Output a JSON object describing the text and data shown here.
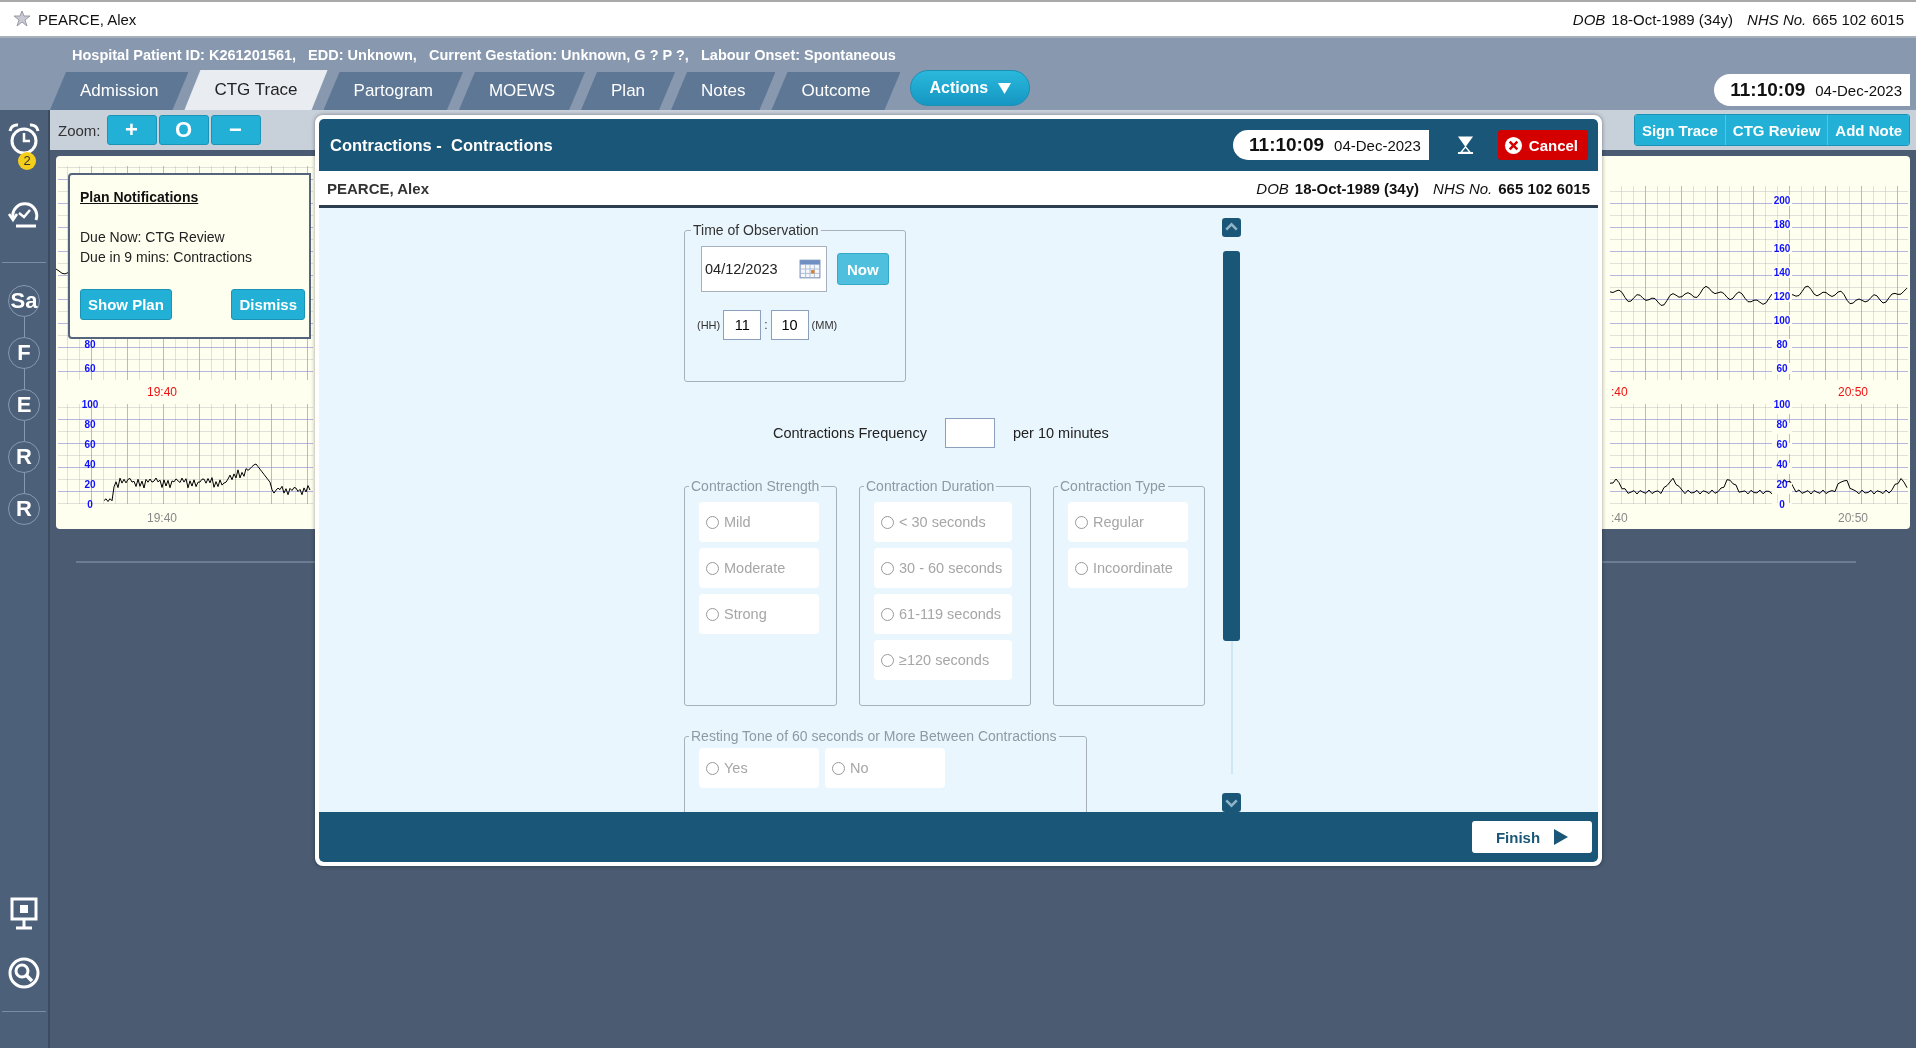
{
  "patient_bar": {
    "name": "PEARCE, Alex",
    "dob_label": "DOB",
    "dob": "18-Oct-1989 (34y)",
    "nhs_label": "NHS No.",
    "nhs": "665 102 6015"
  },
  "info_line": "Hospital Patient ID: K261201561,   EDD: Unknown,   Current Gestation: Unknown, G ? P ?,   Labour Onset: Spontaneous",
  "tabs": [
    {
      "label": "Admission",
      "selected": false
    },
    {
      "label": "CTG Trace",
      "selected": true
    },
    {
      "label": "Partogram",
      "selected": false
    },
    {
      "label": "MOEWS",
      "selected": false
    },
    {
      "label": "Plan",
      "selected": false
    },
    {
      "label": "Notes",
      "selected": false
    },
    {
      "label": "Outcome",
      "selected": false
    }
  ],
  "actions_button": "Actions",
  "clock": {
    "time": "11:10:09",
    "date": "04-Dec-2023"
  },
  "sidebar": {
    "alarm_badge": "2",
    "stages": [
      "Sa",
      "F",
      "E",
      "R",
      "R"
    ]
  },
  "zoom": {
    "label": "Zoom:",
    "buttons": [
      "+",
      "O",
      "−"
    ]
  },
  "trace_buttons": [
    "Sign Trace",
    "CTG Review",
    "Add Note"
  ],
  "ctg": {
    "left": {
      "upper_ticks": [
        "80",
        "60"
      ],
      "marker_time": "19:40",
      "lower_ticks": [
        "100",
        "80",
        "60",
        "40",
        "20",
        "0"
      ],
      "times": [
        "19:40"
      ]
    },
    "right": {
      "upper_ticks": [
        "200",
        "180",
        "160",
        "140",
        "120",
        "100",
        "80",
        "60"
      ],
      "marker_times": [
        ":40",
        "20:50"
      ],
      "lower_ticks": [
        "100",
        "80",
        "60",
        "40",
        "20",
        "0"
      ],
      "times": [
        ":40",
        "20:50"
      ]
    }
  },
  "notification": {
    "title": "Plan Notifications",
    "lines": [
      "Due Now: CTG Review",
      "Due in 9 mins: Contractions"
    ],
    "buttons": [
      "Show Plan",
      "Dismiss"
    ]
  },
  "dialog": {
    "title": "Contractions -  Contractions",
    "clock": {
      "time": "11:10:09",
      "date": "04-Dec-2023"
    },
    "cancel": "Cancel",
    "patient": {
      "name": "PEARCE, Alex",
      "dob_label": "DOB",
      "dob": "18-Oct-1989 (34y)",
      "nhs_label": "NHS No.",
      "nhs": "665 102 6015"
    },
    "observation": {
      "legend": "Time of Observation",
      "date": "04/12/2023",
      "now": "Now",
      "hh_label": "(HH)",
      "hour": "11",
      "separator": ":",
      "minute": "10",
      "mm_label": "(MM)"
    },
    "frequency": {
      "label": "Contractions Frequency",
      "unit": "per 10 minutes"
    },
    "groups": [
      {
        "legend": "Contraction Strength",
        "disabled": true,
        "options": [
          {
            "label": "Mild",
            "selected": false
          },
          {
            "label": "Moderate",
            "selected": false
          },
          {
            "label": "Strong",
            "selected": false
          }
        ]
      },
      {
        "legend": "Contraction Duration",
        "disabled": true,
        "options": [
          {
            "label": "< 30 seconds",
            "selected": false
          },
          {
            "label": "30 - 60 seconds",
            "selected": false
          },
          {
            "label": "61-119 seconds",
            "selected": false
          },
          {
            "label": "≥120 seconds",
            "selected": false
          }
        ]
      },
      {
        "legend": "Contraction Type",
        "disabled": true,
        "options": [
          {
            "label": "Regular",
            "selected": false
          },
          {
            "label": "Incoordinate",
            "selected": false
          }
        ]
      }
    ],
    "resting_tone": {
      "legend": "Resting Tone of 60 seconds or More Between Contractions",
      "disabled": true,
      "options": [
        {
          "label": "Yes",
          "selected": false
        },
        {
          "label": "No",
          "selected": false
        }
      ]
    },
    "finish": "Finish"
  }
}
